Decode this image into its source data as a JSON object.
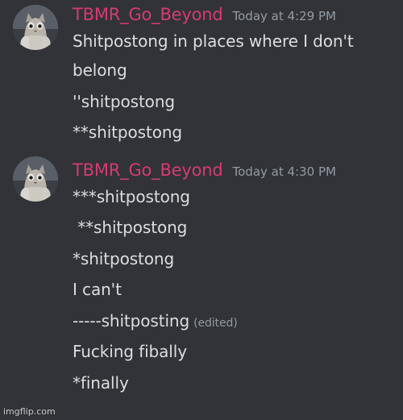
{
  "messages": [
    {
      "username": "TBMR_Go_Beyond",
      "timestamp": "Today at 4:29 PM",
      "lines": [
        "Shitpostong in places where I don't",
        "belong",
        "''shitpostong",
        "**shitpostong"
      ]
    },
    {
      "username": "TBMR_Go_Beyond",
      "timestamp": "Today at 4:30 PM",
      "lines": [
        "***shitpostong",
        " **shitpostong",
        "*shitpostong",
        "I can't",
        "-----shitposting",
        "Fucking fibally",
        "*finally"
      ],
      "edited_label": "(edited)"
    }
  ],
  "watermark": "imgflip.com",
  "colors": {
    "background": "#313338",
    "username": "#d83a72",
    "text": "#dbdee1",
    "muted": "#949ba4"
  },
  "icons": {
    "avatar": "cat-avatar"
  }
}
